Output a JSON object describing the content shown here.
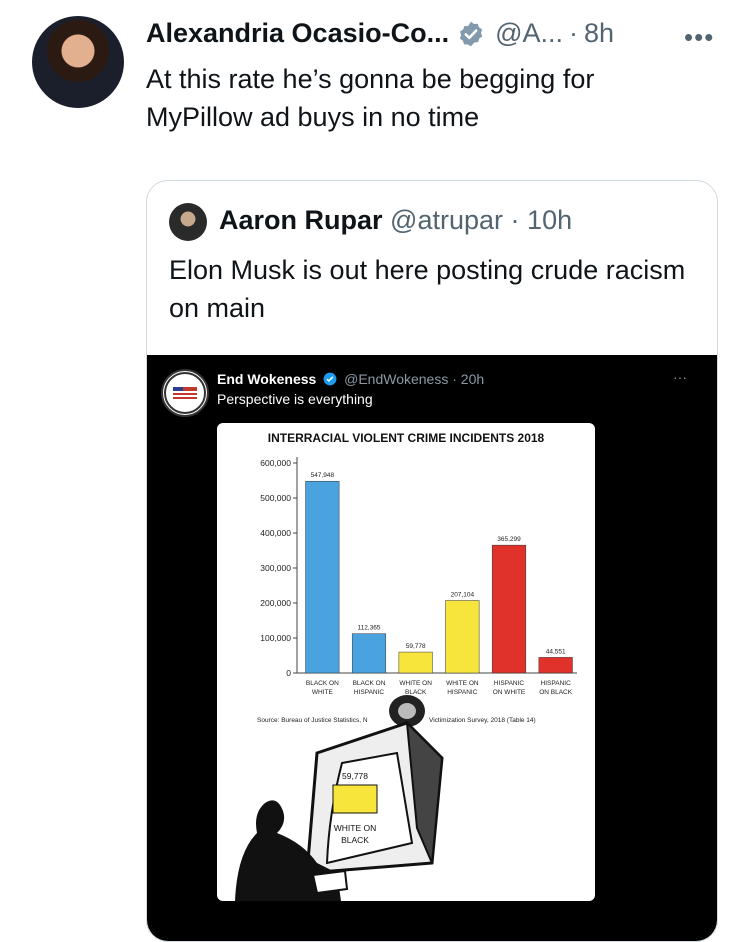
{
  "main_tweet": {
    "name": "Alexandria Ocasio-Co...",
    "handle": "@A...",
    "dot": "·",
    "time": "8h",
    "more": "•••",
    "text": "At this rate he’s gonna be begging for MyPillow ad buys in no time"
  },
  "quote_tweet": {
    "name": "Aaron Rupar",
    "handle": "@atrupar",
    "dot": "·",
    "time": "10h",
    "text": "Elon Musk is out here posting crude racism on main"
  },
  "embedded_post": {
    "name": "End Wokeness",
    "handle": "@EndWokeness",
    "time": "· 20h",
    "text": "Perspective is everything",
    "more": "···"
  },
  "chart_data": {
    "type": "bar",
    "title": "INTERRACIAL VIOLENT CRIME INCIDENTS 2018",
    "categories": [
      "BLACK ON WHITE",
      "BLACK ON HISPANIC",
      "WHITE ON BLACK",
      "WHITE ON HISPANIC",
      "HISPANIC ON WHITE",
      "HISPANIC ON BLACK"
    ],
    "category_lines": [
      [
        "BLACK ON",
        "WHITE"
      ],
      [
        "BLACK ON",
        "HISPANIC"
      ],
      [
        "WHITE ON",
        "BLACK"
      ],
      [
        "WHITE ON",
        "HISPANIC"
      ],
      [
        "HISPANIC",
        "ON WHITE"
      ],
      [
        "HISPANIC",
        "ON BLACK"
      ]
    ],
    "values": [
      547948,
      112365,
      59778,
      207104,
      365299,
      44551
    ],
    "value_labels": [
      "547,948",
      "112,365",
      "59,778",
      "207,104",
      "365,299",
      "44,551"
    ],
    "colors": [
      "#4aa3df",
      "#4aa3df",
      "#f7e53b",
      "#f7e53b",
      "#e0322b",
      "#e0322b"
    ],
    "ylim": [
      0,
      600000
    ],
    "yticks": [
      "0",
      "100,000",
      "200,000",
      "300,000",
      "400,000",
      "500,000",
      "600,000"
    ],
    "source": "Source: Bureau of Justice Statistics, N",
    "source_end": "Victimization Survey, 2018 (Table 14)",
    "zoom_value": "59,778",
    "zoom_lines": [
      "WHITE ON",
      "BLACK"
    ]
  }
}
